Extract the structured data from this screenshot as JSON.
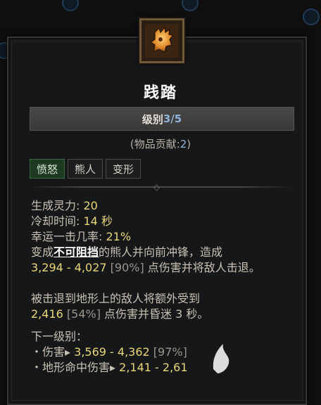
{
  "skill": {
    "title": "践踏",
    "rank_label": "级别",
    "rank_current": "3",
    "rank_sep": "/",
    "rank_max": "5",
    "contribution_prefix": "(物品贡献:",
    "contribution_value": "2",
    "contribution_suffix": ")",
    "icon": "bear-paw-icon"
  },
  "tags": [
    {
      "label": "愤怒",
      "active": true
    },
    {
      "label": "熊人",
      "active": false
    },
    {
      "label": "变形",
      "active": false
    }
  ],
  "stats": {
    "spirit_label": "生成灵力:",
    "spirit_value": "20",
    "cooldown_label": "冷却时间:",
    "cooldown_value": "14 秒",
    "lucky_label": "幸运一击几率:",
    "lucky_value": "21%",
    "desc1_a": "变成",
    "desc1_keyword": "不可阻挡",
    "desc1_b": "的熊人并向前冲锋，造成",
    "desc2_range": "3,294 - 4,027",
    "desc2_pct": "[90%]",
    "desc2_rest": " 点伤害并将敌人击退。",
    "desc3": "被击退到地形上的敌人将额外受到",
    "desc4_val": "2,416",
    "desc4_pct": "[54%]",
    "desc4_rest": " 点伤害并昏迷 3 秒。",
    "next_rank_label": "下一级别：",
    "next1_label": "・伤害",
    "next1_arrow": "▸",
    "next1_value": "3,569 - 4,362",
    "next1_pct": "[97%]",
    "next2_label": "・地形命中伤害",
    "next2_arrow": "▸",
    "next2_value": "2,141 - 2,61"
  },
  "colors": {
    "value_yellow": "#e9d779",
    "value_blue": "#8fb3d9",
    "active_tag_green": "#1f3a23"
  }
}
